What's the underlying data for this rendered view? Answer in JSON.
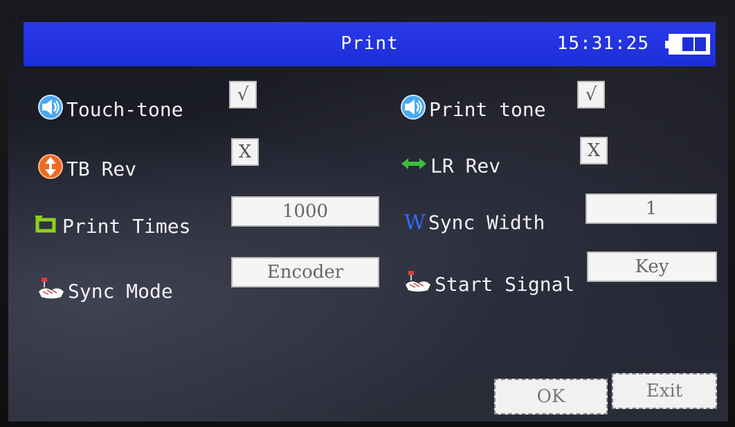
{
  "header": {
    "title": "Print",
    "time": "15:31:25",
    "battery_icon": "battery-icon",
    "color": "#1f30dd"
  },
  "settings": {
    "touch_tone": {
      "label": "Touch-tone",
      "value": "√",
      "icon": "speaker-icon"
    },
    "print_tone": {
      "label": "Print tone",
      "value": "√",
      "icon": "speaker-icon"
    },
    "tb_rev": {
      "label": "TB Rev",
      "value": "X",
      "icon": "flip-vertical-icon"
    },
    "lr_rev": {
      "label": "LR Rev",
      "value": "X",
      "icon": "flip-horizontal-arrow-icon"
    },
    "print_times": {
      "label": "Print Times",
      "value": "1000",
      "icon": "repeat-icon"
    },
    "sync_width": {
      "label": "Sync Width",
      "value": "1",
      "icon": "w-letter-icon",
      "icon_text": "W"
    },
    "sync_mode": {
      "label": "Sync Mode",
      "value": "Encoder",
      "icon": "handshake-icon"
    },
    "start_signal": {
      "label": "Start Signal",
      "value": "Key",
      "icon": "handshake-icon"
    }
  },
  "buttons": {
    "ok": "OK",
    "exit": "Exit"
  }
}
